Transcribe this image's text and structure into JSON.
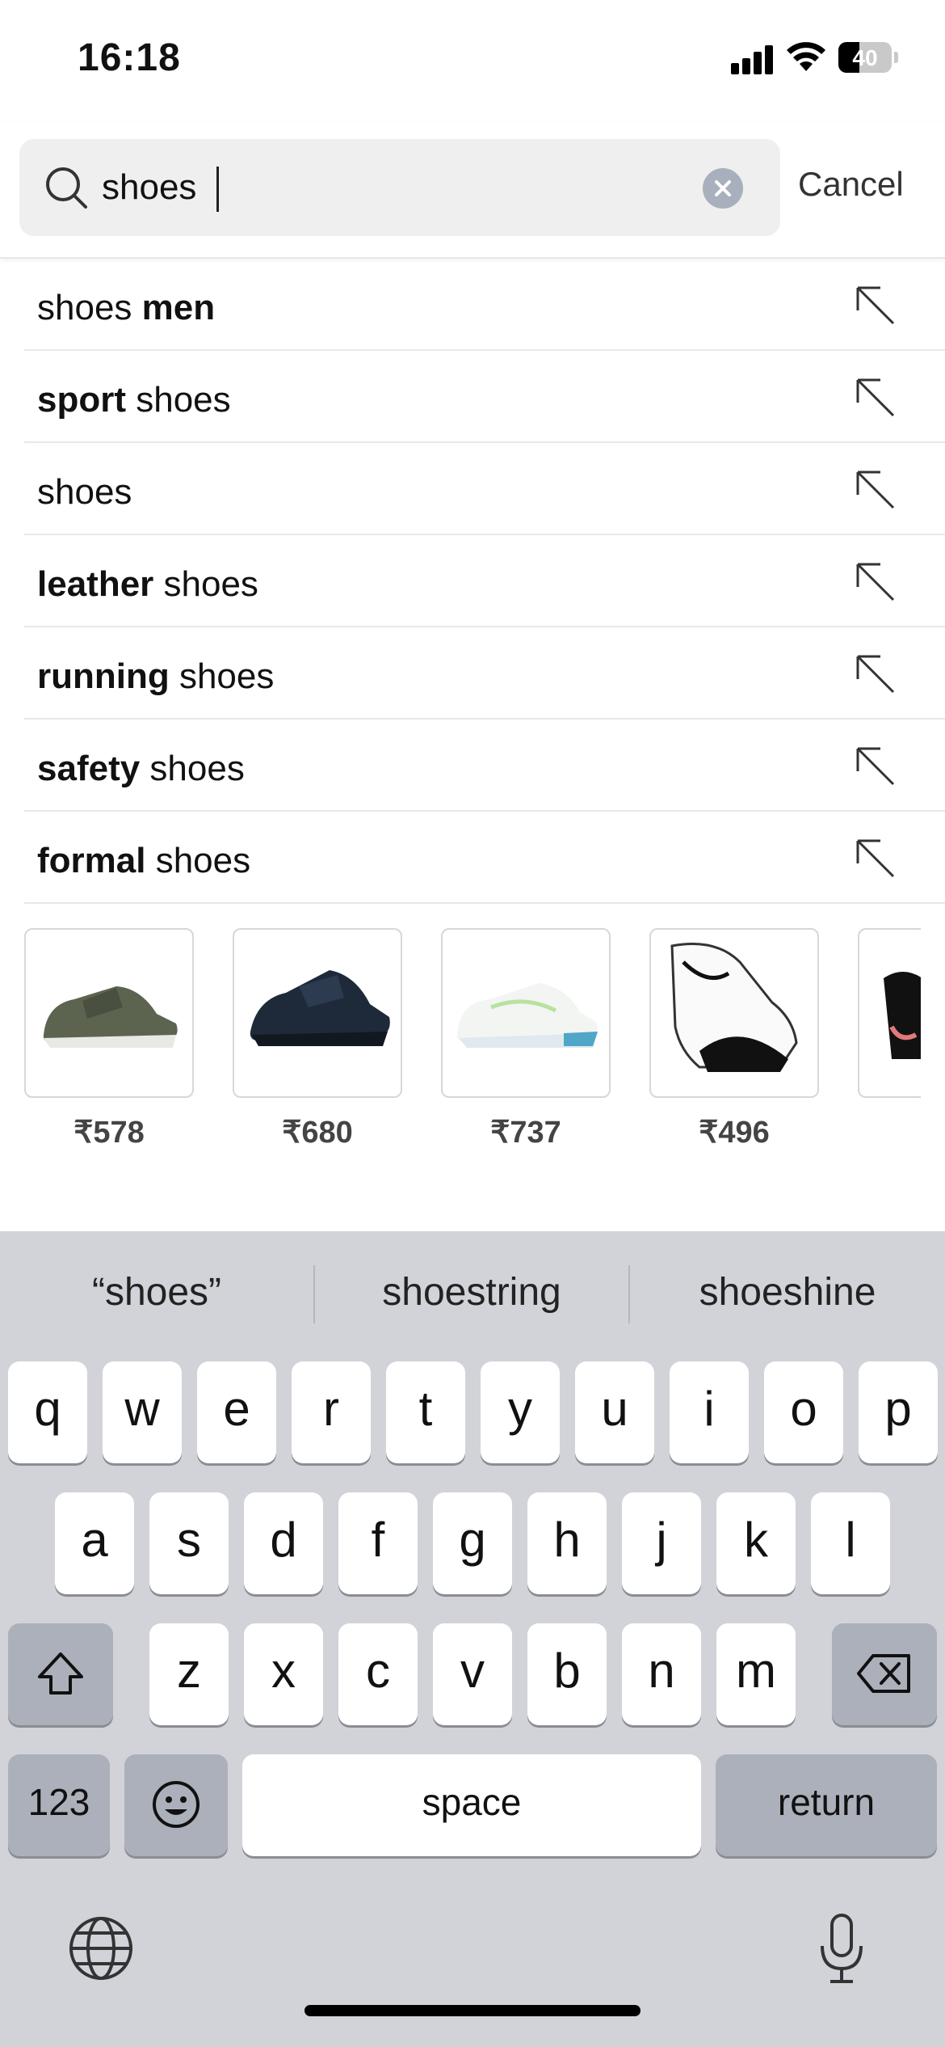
{
  "status_bar": {
    "time": "16:18",
    "battery": "40",
    "battery_level": 0.4
  },
  "search": {
    "query": "shoes",
    "cancel_label": "Cancel"
  },
  "suggestions": [
    {
      "normal_before": "shoes ",
      "bold": "men",
      "normal_after": ""
    },
    {
      "normal_before": "",
      "bold": "sport",
      "normal_after": " shoes"
    },
    {
      "normal_before": "shoes",
      "bold": "",
      "normal_after": ""
    },
    {
      "normal_before": "",
      "bold": "leather",
      "normal_after": " shoes"
    },
    {
      "normal_before": "",
      "bold": "running",
      "normal_after": " shoes"
    },
    {
      "normal_before": "",
      "bold": "safety",
      "normal_after": " shoes"
    },
    {
      "normal_before": "",
      "bold": "formal",
      "normal_after": " shoes"
    }
  ],
  "products": [
    {
      "price": "₹578"
    },
    {
      "price": "₹680"
    },
    {
      "price": "₹737"
    },
    {
      "price": "₹496"
    },
    {
      "price": "₹"
    }
  ],
  "keyboard": {
    "predictions": [
      "“shoes”",
      "shoestring",
      "shoeshine"
    ],
    "row1": [
      "q",
      "w",
      "e",
      "r",
      "t",
      "y",
      "u",
      "i",
      "o",
      "p"
    ],
    "row2": [
      "a",
      "s",
      "d",
      "f",
      "g",
      "h",
      "j",
      "k",
      "l"
    ],
    "row3": [
      "z",
      "x",
      "c",
      "v",
      "b",
      "n",
      "m"
    ],
    "numbers_label": "123",
    "space_label": "space",
    "return_label": "return",
    "shift_icon": "shift-icon",
    "delete_icon": "delete-icon",
    "emoji_icon": "emoji-icon",
    "globe_icon": "globe-icon",
    "mic_icon": "microphone-icon"
  }
}
